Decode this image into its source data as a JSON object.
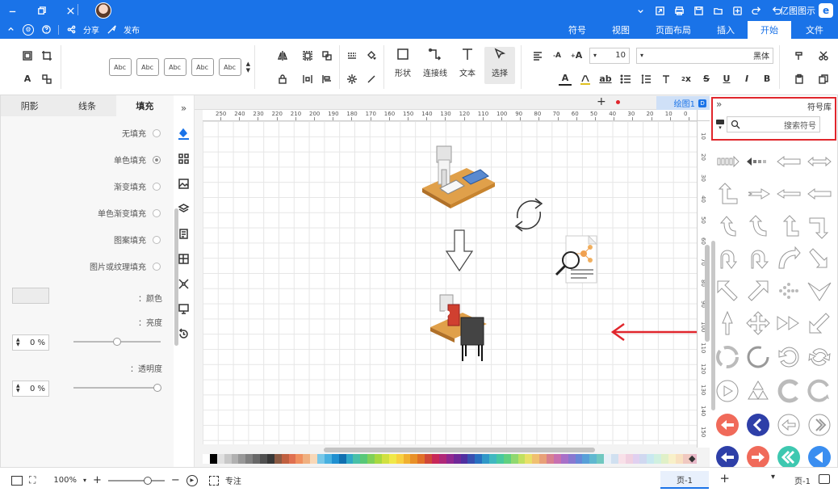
{
  "titlebar": {
    "app_title": "亿图图示"
  },
  "tabs": [
    {
      "label": "文件"
    },
    {
      "label": "开始"
    },
    {
      "label": "插入"
    },
    {
      "label": "页面布局"
    },
    {
      "label": "视图"
    },
    {
      "label": "符号"
    }
  ],
  "tabbar_left": {
    "publish_label": "发布",
    "share_label": "分享"
  },
  "ribbon": {
    "font_name": "黑体",
    "font_size": "10",
    "select_label": "选择",
    "text_label": "文本",
    "connector_label": "连接线",
    "shape_label": "形状",
    "style_preview": "Abc"
  },
  "fill_panel": {
    "tabs": [
      "填充",
      "线条",
      "阴影"
    ],
    "options": [
      "无填充",
      "单色填充",
      "渐变填充",
      "单色渐变填充",
      "图案填充",
      "图片或纹理填充"
    ],
    "color_label": "颜色：",
    "brightness_label": "亮度：",
    "brightness_value": "0 %",
    "transparency_label": "透明度：",
    "transparency_value": "0 %"
  },
  "document": {
    "tab_label": "绘图1",
    "ruler_marks": [
      "0",
      "10",
      "20",
      "30",
      "40",
      "50",
      "60",
      "70",
      "80",
      "90",
      "100",
      "110",
      "120",
      "130",
      "140",
      "150",
      "160",
      "170",
      "180",
      "190",
      "200",
      "210",
      "220",
      "230",
      "240",
      "250"
    ],
    "v_ruler_marks": [
      "10",
      "20",
      "30",
      "40",
      "50",
      "60",
      "70",
      "80",
      "90",
      "100",
      "110",
      "120",
      "130",
      "140",
      "150"
    ]
  },
  "library": {
    "title": "符号库",
    "search_placeholder": "搜索符号"
  },
  "status": {
    "page_label": "页-1",
    "page_tab": "页-1",
    "focus_label": "专注",
    "zoom": "100%"
  },
  "palette": [
    "#ffffff",
    "#000000",
    "#e0e0e0",
    "#c8c8c8",
    "#b0b0b0",
    "#989898",
    "#808080",
    "#686868",
    "#505050",
    "#383838",
    "#8a5a44",
    "#c06040",
    "#e07050",
    "#f09060",
    "#f0b080",
    "#f8d8b8",
    "#78c8e8",
    "#48b0e0",
    "#2090d0",
    "#1070b0",
    "#30a8c8",
    "#48c0a8",
    "#58c878",
    "#80d058",
    "#a8d840",
    "#d0e040",
    "#f0e848",
    "#f8d040",
    "#f0b030",
    "#e89028",
    "#e07028",
    "#d04838",
    "#c82858",
    "#b02878",
    "#902890",
    "#702898",
    "#5030a0",
    "#3850b0",
    "#2870c0",
    "#3098c8",
    "#40b8c0",
    "#48c8a0",
    "#60d080",
    "#90d870",
    "#c0e060",
    "#e8e068",
    "#f0c070",
    "#e8a078",
    "#d88090",
    "#c870b0",
    "#a870c8",
    "#8878d0",
    "#6888d8",
    "#58a0d8",
    "#60b8d0",
    "#70c8c0",
    "#e8f0f8",
    "#d0e0f0",
    "#f8e0e8",
    "#f0d0e0",
    "#e0d0f0",
    "#d0d8f0",
    "#c8e8f0",
    "#d0f0e0",
    "#e0f0c8",
    "#f8f0c8",
    "#f8e0c0",
    "#f0c8c0",
    "#e8b8c8"
  ],
  "colors": {
    "accent": "#1a73e8",
    "highlight_box": "#e0262c",
    "arrow_red": "#e0262c",
    "shape_red": "#f06a5a",
    "shape_navy": "#2e3fa8",
    "shape_teal": "#3ec8b0",
    "shape_blue": "#3a8ef0"
  }
}
